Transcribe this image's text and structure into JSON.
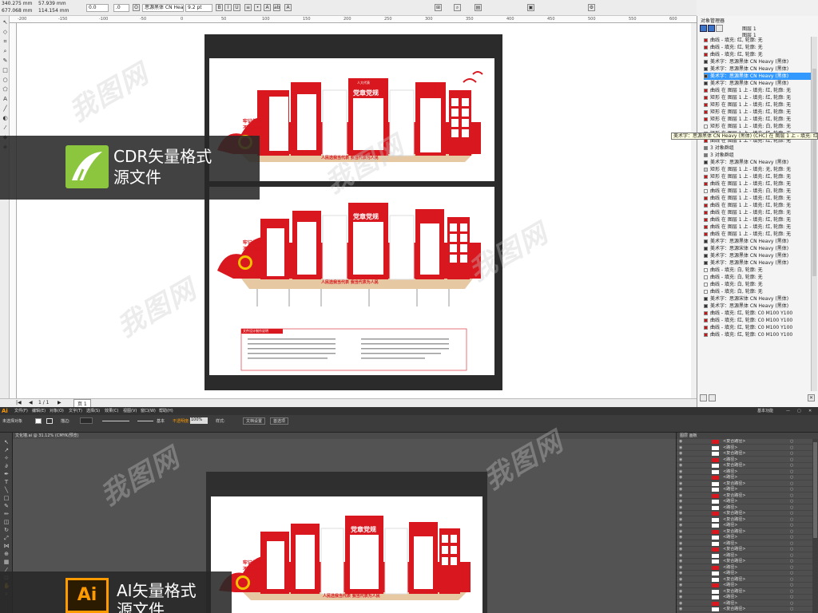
{
  "cdr": {
    "coords": {
      "x": "340.275 mm",
      "y": "677.068 mm",
      "w": "57.939 mm",
      "h": "114.154 mm"
    },
    "zero_a": "0.0",
    "zero_b": ".0",
    "font_name": "思源黑体 CN Heavy",
    "font_size": "9.2 pt",
    "ruler_ticks": [
      "-200",
      "-150",
      "-100",
      "-50",
      "0",
      "50",
      "100",
      "150",
      "200",
      "250",
      "300",
      "350",
      "400",
      "450",
      "500",
      "550",
      "600"
    ],
    "page_nav": "1 / 1",
    "page_tab": "页 1",
    "badge_line1": "CDR矢量格式",
    "badge_line2": "源文件"
  },
  "object_manager": {
    "title": "对象管理器",
    "layers": [
      "图层 1",
      "图层 1"
    ],
    "rows": [
      {
        "text": "曲线 - 填充: 红, 轮廓: 无",
        "c": "#cc1111"
      },
      {
        "text": "曲线 - 填充: 红, 轮廓: 无",
        "c": "#cc1111"
      },
      {
        "text": "曲线 - 填充: 红, 轮廓: 无",
        "c": "#cc1111"
      },
      {
        "text": "美术字：思源黑体 CN Heavy (黑体)",
        "c": "#333333"
      },
      {
        "text": "美术字：思源黑体 CN Heavy (黑体)",
        "c": "#333333"
      },
      {
        "text": "美术字：思源黑体 CN Heavy (黑体)",
        "c": "#333333",
        "sel": true
      },
      {
        "text": "美术字：思源黑体 CN Heavy (黑体)",
        "c": "#333333"
      },
      {
        "text": "曲线 在 图层 1 上 - 填充: 红, 轮廓: 无",
        "c": "#cc1111"
      },
      {
        "text": "矩形 在 图层 1 上 - 填充: 红, 轮廓: 无",
        "c": "#cc1111"
      },
      {
        "text": "矩形 在 图层 1 上 - 填充: 红, 轮廓: 无",
        "c": "#cc1111"
      },
      {
        "text": "矩形 在 图层 1 上 - 填充: 红, 轮廓: 无",
        "c": "#cc1111"
      },
      {
        "text": "矩形 在 图层 1 上 - 填充: 红, 轮廓: 无",
        "c": "#cc1111"
      },
      {
        "text": "矩形 在 图层 1 上 - 填充: 白, 轮廓: 无",
        "c": "#ffffff"
      },
      {
        "text": "矩形 在 图层 1 上 - 填充: 红, 轮廓: 无",
        "c": "#cc1111"
      },
      {
        "text": "曲线 在 图层 1 上 - 填充: 红, 轮廓: 无",
        "c": "#cc1111"
      },
      {
        "text": "3 对象群组",
        "c": "#777777"
      },
      {
        "text": "3 对象群组",
        "c": "#777777"
      },
      {
        "text": "美术字：思源黑体 CN Heavy (黑体)",
        "c": "#333333"
      },
      {
        "text": "矩形 在 图层 1 上 - 填充: 无, 轮廓: 无",
        "c": "#cccccc"
      },
      {
        "text": "矩形 在 图层 1 上 - 填充: 红, 轮廓: 无",
        "c": "#cc1111"
      },
      {
        "text": "曲线 在 图层 1 上 - 填充: 红, 轮廓: 无",
        "c": "#cc1111"
      },
      {
        "text": "曲线 在 图层 1 上 - 填充: 白, 轮廓: 无",
        "c": "#ffffff"
      },
      {
        "text": "曲线 在 图层 1 上 - 填充: 红, 轮廓: 无",
        "c": "#cc1111"
      },
      {
        "text": "曲线 在 图层 1 上 - 填充: 红, 轮廓: 无",
        "c": "#cc1111"
      },
      {
        "text": "曲线 在 图层 1 上 - 填充: 红, 轮廓: 无",
        "c": "#cc1111"
      },
      {
        "text": "曲线 在 图层 1 上 - 填充: 红, 轮廓: 无",
        "c": "#cc1111"
      },
      {
        "text": "曲线 在 图层 1 上 - 填充: 红, 轮廓: 无",
        "c": "#cc1111"
      },
      {
        "text": "曲线 在 图层 1 上 - 填充: 红, 轮廓: 无",
        "c": "#cc1111"
      },
      {
        "text": "美术字：思源黑体 CN Heavy (黑体)",
        "c": "#333333"
      },
      {
        "text": "美术字：思源宋体 CN Heavy (黑体)",
        "c": "#333333"
      },
      {
        "text": "美术字：思源黑体 CN Heavy (黑体)",
        "c": "#333333"
      },
      {
        "text": "美术字：思源黑体 CN Heavy (黑体)",
        "c": "#333333"
      },
      {
        "text": "曲线 - 填充: 白, 轮廓: 无",
        "c": "#ffffff"
      },
      {
        "text": "曲线 - 填充: 白, 轮廓: 无",
        "c": "#ffffff"
      },
      {
        "text": "曲线 - 填充: 白, 轮廓: 无",
        "c": "#ffffff"
      },
      {
        "text": "曲线 - 填充: 白, 轮廓: 无",
        "c": "#ffffff"
      },
      {
        "text": "美术字：思源宋体 CN Heavy (黑体)",
        "c": "#333333"
      },
      {
        "text": "美术字：思源黑体 CN Heavy (黑体)",
        "c": "#333333"
      },
      {
        "text": "曲线 - 填充: 红, 轮廓: C0 M100 Y100",
        "c": "#cc1111"
      },
      {
        "text": "曲线 - 填充: 红, 轮廓: C0 M100 Y100",
        "c": "#cc1111"
      },
      {
        "text": "曲线 - 填充: 红, 轮廓: C0 M100 Y100",
        "c": "#cc1111"
      },
      {
        "text": "曲线 - 填充: 红, 轮廓: C0 M100 Y100",
        "c": "#cc1111"
      }
    ],
    "tooltip": "美术字：思源黑体 CN Heavy (黑体) (CHC) 在 图层 1 上 - 填充: 红, 轮廓: 无"
  },
  "design": {
    "slogan_a": "牢记使命",
    "slogan_b": "不忘初心",
    "banner_small": "人大代表",
    "banner_main": "党章党规",
    "side_text": "依法履行代表职责 为人民服务",
    "base_text": "人民选我当代表  我当代表为人民",
    "spec_title": "文件设计制作说明"
  },
  "ai": {
    "app": "Ai",
    "menu": [
      "文件(F)",
      "编辑(E)",
      "对象(O)",
      "文字(T)",
      "选择(S)",
      "效果(C)",
      "视图(V)",
      "窗口(W)",
      "帮助(H)"
    ],
    "workspace": "基本功能",
    "no_selection": "未选择对象",
    "stroke_label": "描边:",
    "style_a": "基本",
    "opacity_label": "不透明度:",
    "opacity": "100%",
    "style_b": "样式:",
    "doc_setup": "文档设置",
    "prefs": "首选项",
    "doc_tab": "文化墙.ai @ 31.12% (CMYK/预览)",
    "layers_header": "图层 画板",
    "layers": [
      "<复合路径>",
      "<路径>",
      "<复合路径>",
      "<路径>",
      "<复合路径>",
      "<路径>",
      "<路径>",
      "<复合路径>",
      "<路径>",
      "<复合路径>",
      "<路径>",
      "<路径>",
      "<复合路径>",
      "<复合路径>",
      "<路径>",
      "<复合路径>",
      "<路径>",
      "<路径>",
      "<复合路径>",
      "<路径>",
      "<复合路径>",
      "<路径>",
      "<路径>",
      "<复合路径>",
      "<路径>",
      "<复合路径>",
      "<路径>",
      "<路径>",
      "<复合路径>"
    ],
    "badge_line1": "AI矢量格式",
    "badge_line2": "源文件"
  }
}
